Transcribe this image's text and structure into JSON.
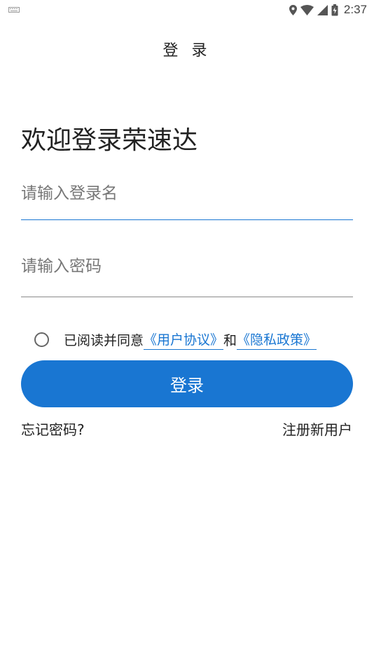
{
  "status_bar": {
    "time": "2:37"
  },
  "header": {
    "title": "登 录"
  },
  "welcome": "欢迎登录荣速达",
  "form": {
    "username_placeholder": "请输入登录名",
    "username_value": "",
    "password_placeholder": "请输入密码",
    "password_value": ""
  },
  "agreement": {
    "prefix": "已阅读并同意",
    "user_agreement": "《用户协议》",
    "conjunction": "和",
    "privacy_policy": "《隐私政策》"
  },
  "login_button": "登录",
  "forgot_password": "忘记密码?",
  "register": "注册新用户",
  "colors": {
    "accent": "#1976d2",
    "background": "#ffffff",
    "text": "#222222"
  }
}
